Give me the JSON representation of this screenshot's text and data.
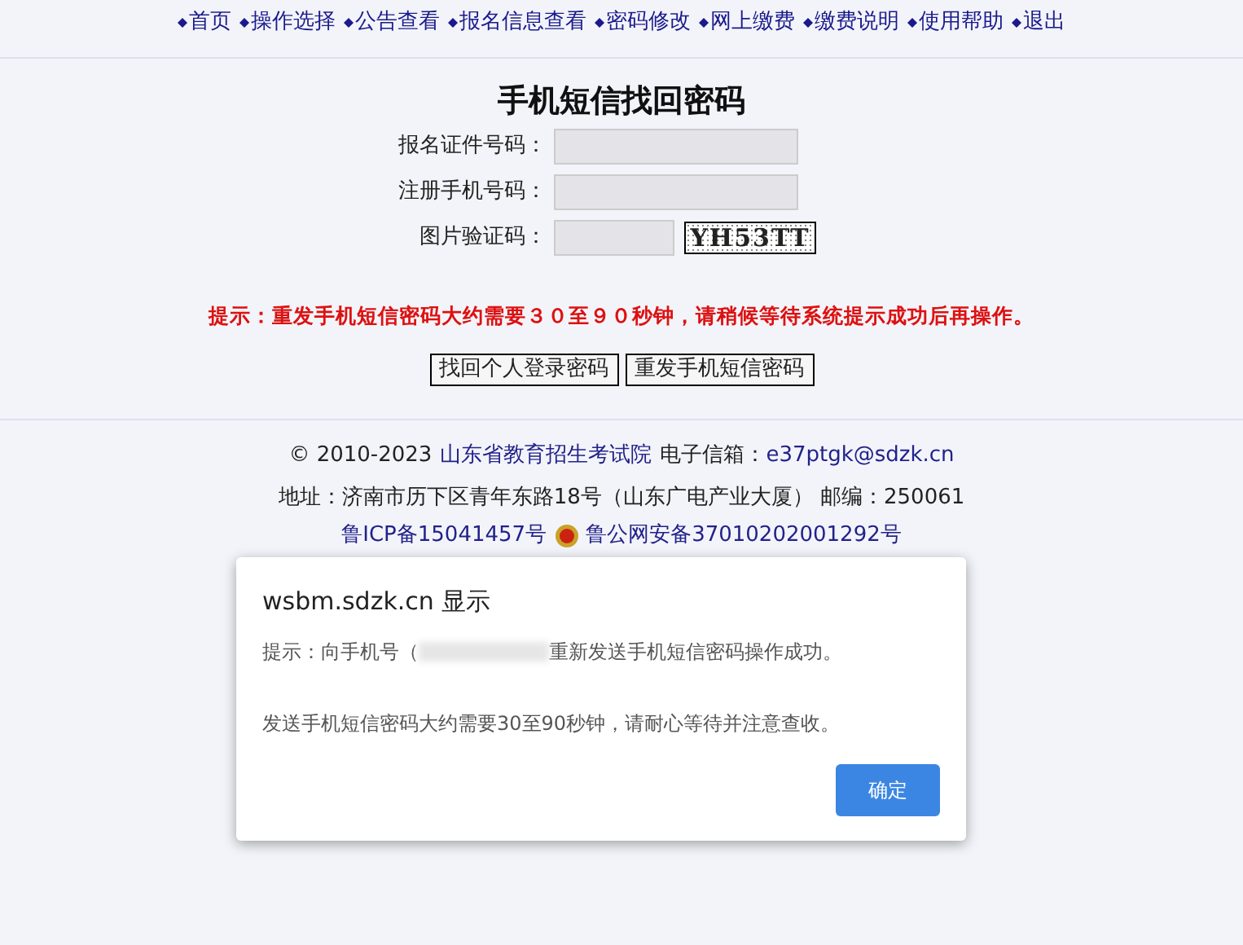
{
  "nav": [
    {
      "label": "首页"
    },
    {
      "label": "操作选择"
    },
    {
      "label": "公告查看"
    },
    {
      "label": "报名信息查看"
    },
    {
      "label": "密码修改"
    },
    {
      "label": "网上缴费"
    },
    {
      "label": "缴费说明"
    },
    {
      "label": "使用帮助"
    },
    {
      "label": "退出"
    }
  ],
  "title": "手机短信找回密码",
  "form": [
    {
      "label": "报名证件号码：",
      "kind": "long"
    },
    {
      "label": "注册手机号码：",
      "kind": "long"
    },
    {
      "label": "图片验证码：",
      "kind": "captcha",
      "captcha": "YH53TT"
    }
  ],
  "hint": "提示：重发手机短信密码大约需要３０至９０秒钟，请稍候等待系统提示成功后再操作。",
  "buttons": [
    {
      "label": "找回个人登录密码"
    },
    {
      "label": "重发手机短信密码"
    }
  ],
  "footer": {
    "copyright": "© 2010-2023",
    "org_link": "山东省教育招生考试院",
    "email_label": "电子信箱：",
    "email": "e37ptgk@sdzk.cn",
    "address": "地址：济南市历下区青年东路18号（山东广电产业大厦） 邮编：250061",
    "icp": "鲁ICP备15041457号",
    "police": "鲁公网安备37010202001292号"
  },
  "dialog": {
    "title": "wsbm.sdzk.cn 显示",
    "message_start": "提示：向手机号（",
    "message_end": "重新发送手机短信密码操作成功。",
    "note": "发送手机短信密码大约需要30至90秒钟，请耐心等待并注意查收。",
    "ok": "确定"
  }
}
